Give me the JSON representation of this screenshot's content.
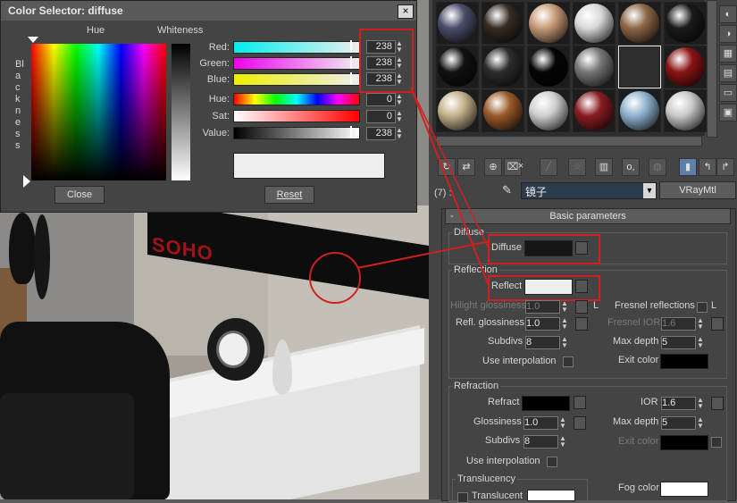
{
  "color_selector": {
    "title": "Color Selector: diffuse",
    "hue_label": "Hue",
    "whiteness_label": "Whiteness",
    "blackness_label": "Blackness",
    "rows": [
      {
        "label": "Red:",
        "value": "238"
      },
      {
        "label": "Green:",
        "value": "238"
      },
      {
        "label": "Blue:",
        "value": "238"
      },
      {
        "label": "Hue:",
        "value": "0"
      },
      {
        "label": "Sat:",
        "value": "0"
      },
      {
        "label": "Value:",
        "value": "238"
      }
    ],
    "close_label": "Close",
    "reset_label": "Reset",
    "preview_color": "#eeeeee"
  },
  "viewport": {
    "sign_text": "SOHO"
  },
  "material_editor": {
    "slot_colors": [
      [
        "#4b4d6a",
        "#352b22",
        "#c89b78",
        "#d9d9d9",
        "#8e6748",
        "#1a1a1a"
      ],
      [
        "#111111",
        "#2d2d2d",
        "#050505",
        "#777777",
        "#2e2e2e",
        "#8b1414"
      ],
      [
        "#c5b18a",
        "#9a5a2a",
        "#cfcfcf",
        "#8a1d22",
        "#8fb2cf",
        "#c9c9c9"
      ]
    ],
    "toolbar": {
      "close_x": "×",
      "spin_o": "o,"
    },
    "material_id": "(7) :",
    "material_name": "镜子",
    "material_type": "VRayMtl",
    "rollout_title": "Basic parameters",
    "diffuse_group": "Diffuse",
    "diffuse_label": "Diffuse",
    "diffuse_color": "#161616",
    "reflection_group": "Reflection",
    "reflect_label": "Reflect",
    "reflect_color": "#eeeeee",
    "hilight_label": "Hilight glossiness",
    "hilight_value": "1.0",
    "hilight_lock": "L",
    "fresnel_label": "Fresnel reflections",
    "fresnel_lock": "L",
    "refl_gloss_label": "Refl. glossiness",
    "refl_gloss_value": "1.0",
    "fresnel_ior_label": "Fresnel IOR",
    "fresnel_ior_value": "1.6",
    "subdivs_label": "Subdivs",
    "subdivs_value": "8",
    "max_depth_label": "Max depth",
    "max_depth_value": "5",
    "use_interp_label": "Use interpolation",
    "exit_color_label": "Exit color",
    "refraction_group": "Refraction",
    "refract_label": "Refract",
    "ior_label": "IOR",
    "ior_value": "1.6",
    "glossiness_label": "Glossiness",
    "glossiness_value": "1.0",
    "refr_max_depth_label": "Max depth",
    "refr_max_depth_value": "5",
    "refr_subdivs_label": "Subdivs",
    "refr_subdivs_value": "8",
    "refr_exit_label": "Exit color",
    "refr_use_interp_label": "Use interpolation",
    "translucency_group": "Translucency",
    "translucent_label": "Translucent",
    "fog_color_label": "Fog color"
  }
}
